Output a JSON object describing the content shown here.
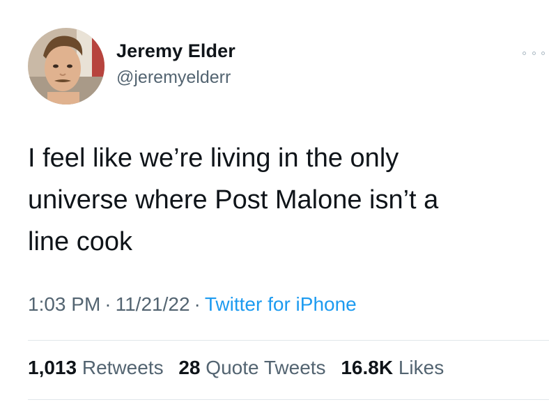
{
  "author": {
    "name": "Jeremy Elder",
    "handle": "@jeremyelderr",
    "avatar_icon": "profile-photo-icon"
  },
  "more_icon": "ellipsis-icon",
  "tweet": {
    "lines": [
      "I feel like we’re living in the only",
      "universe where Post Malone isn’t a",
      "line cook"
    ]
  },
  "meta": {
    "time": "1:03 PM",
    "separator": "·",
    "date": "11/21/22",
    "source": "Twitter for iPhone"
  },
  "stats": {
    "retweets_count": "1,013",
    "retweets_label": "Retweets",
    "quotes_count": "28",
    "quotes_label": "Quote Tweets",
    "likes_count": "16.8K",
    "likes_label": "Likes"
  },
  "colors": {
    "text": "#0f1419",
    "secondary": "#536471",
    "link": "#1d9bf0",
    "divider": "#e1e6ea"
  }
}
